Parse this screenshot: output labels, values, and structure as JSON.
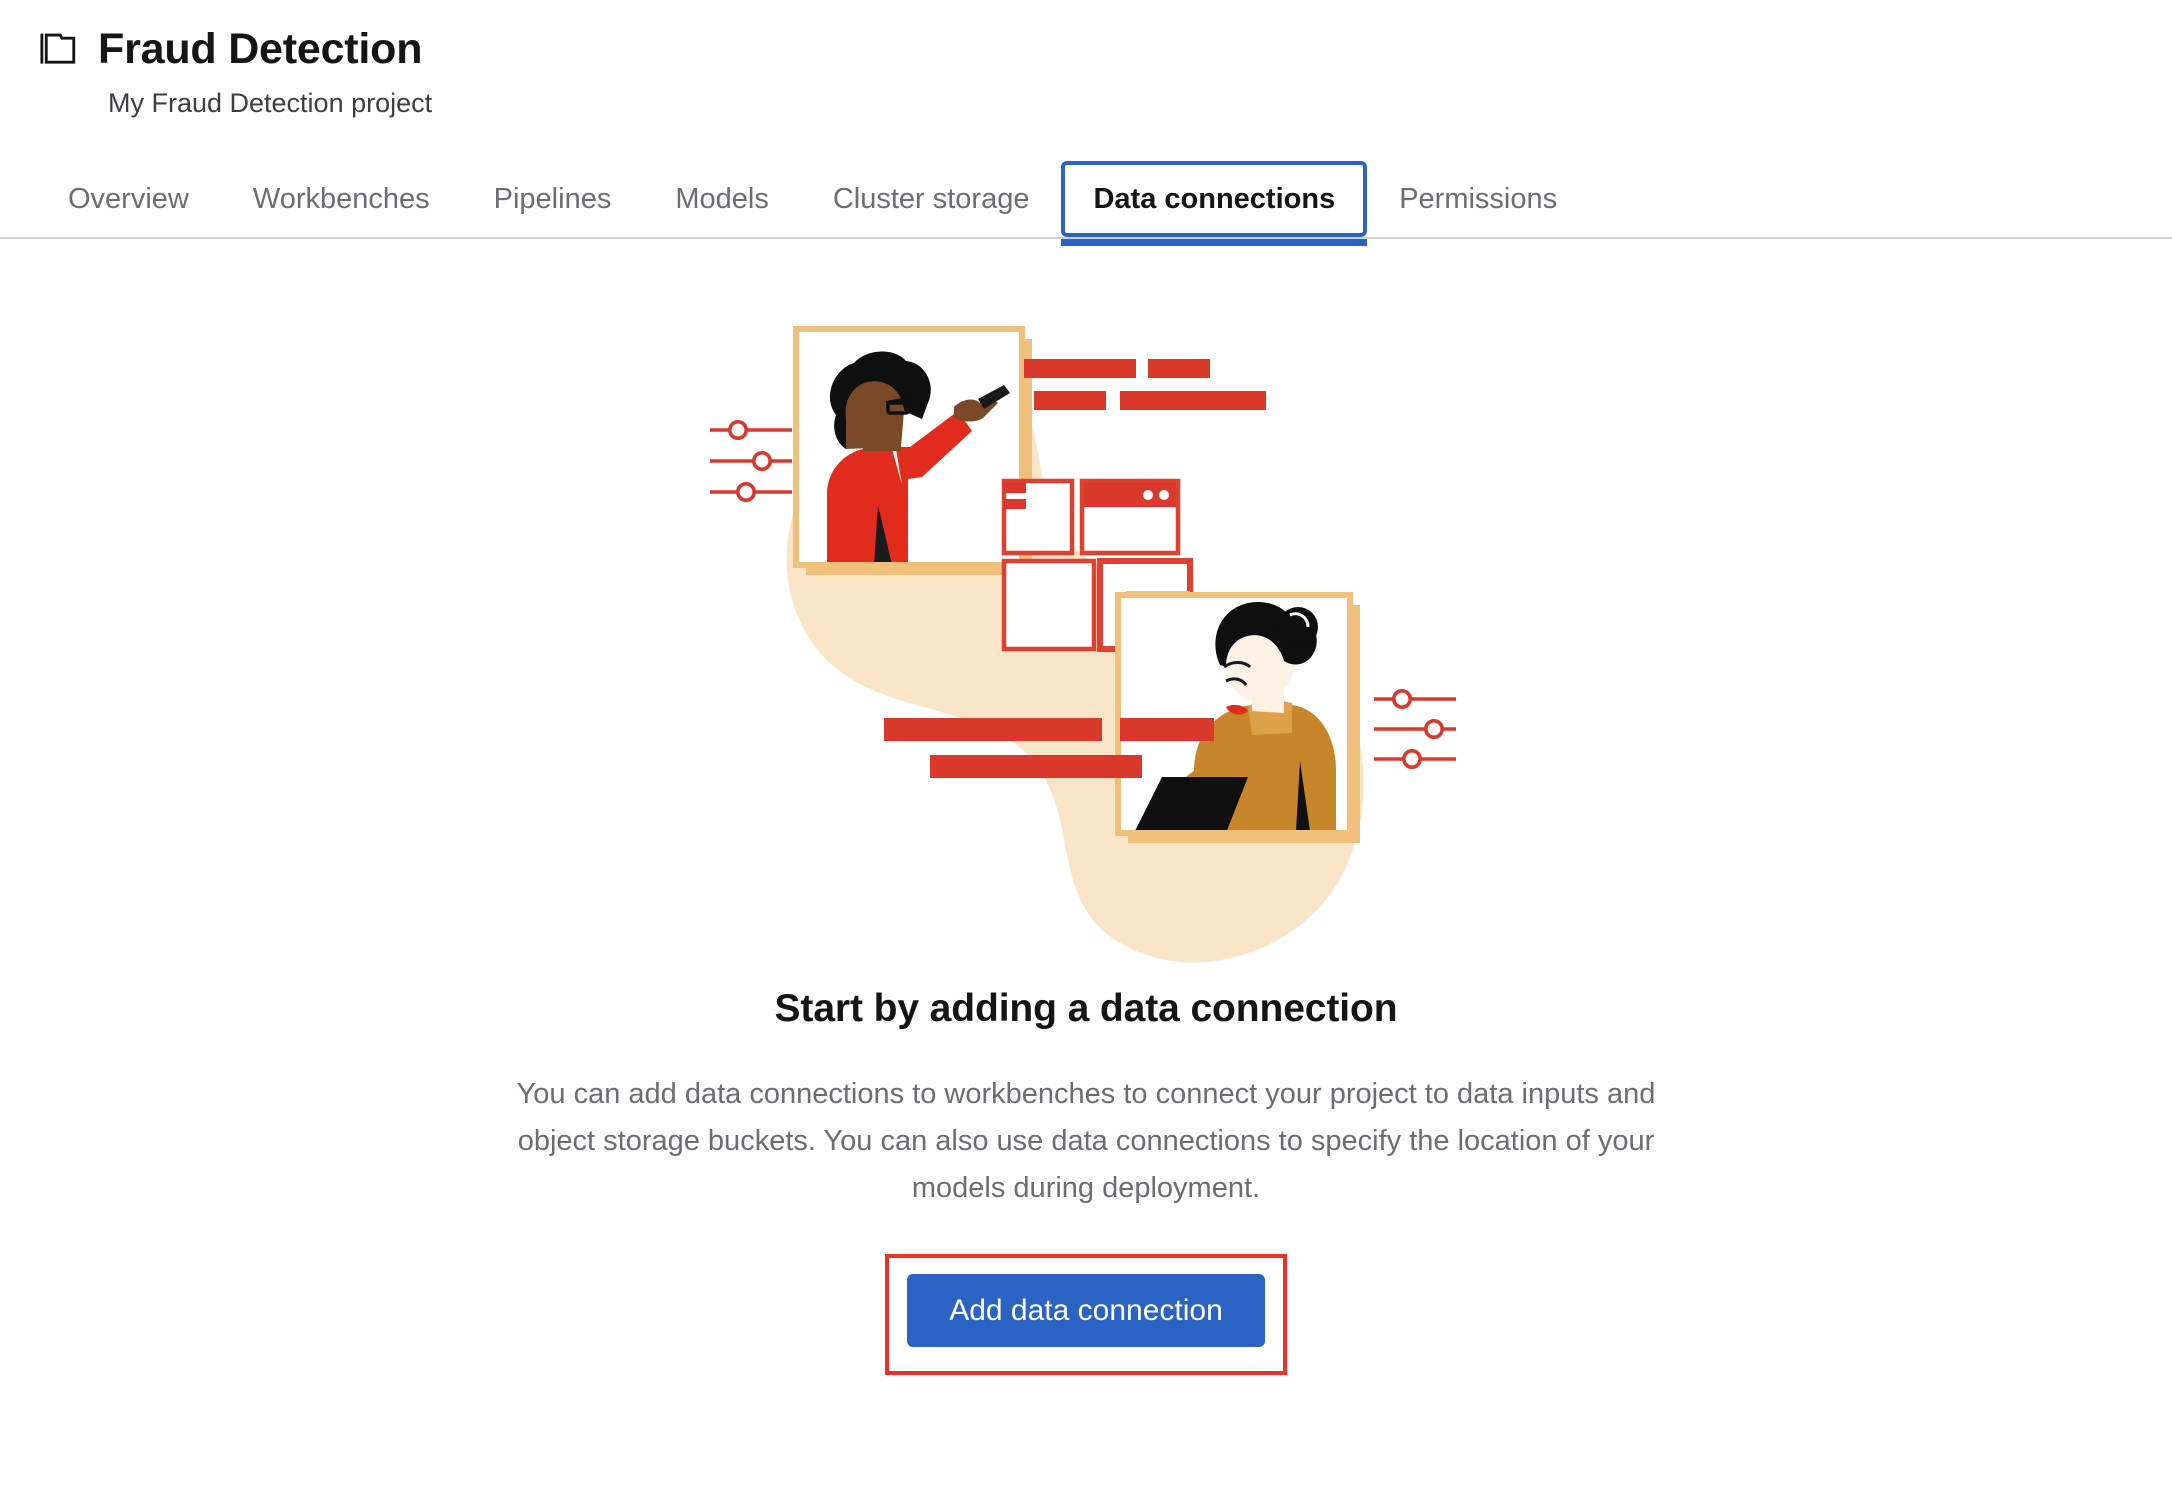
{
  "header": {
    "icon": "folder-icon",
    "title": "Fraud Detection",
    "subtitle": "My Fraud Detection project"
  },
  "tabs": [
    {
      "label": "Overview",
      "active": false
    },
    {
      "label": "Workbenches",
      "active": false
    },
    {
      "label": "Pipelines",
      "active": false
    },
    {
      "label": "Models",
      "active": false
    },
    {
      "label": "Cluster storage",
      "active": false
    },
    {
      "label": "Data connections",
      "active": true
    },
    {
      "label": "Permissions",
      "active": false
    }
  ],
  "empty_state": {
    "illustration_name": "data-connections-empty-illustration",
    "title": "Start by adding a data connection",
    "body": "You can add data connections to workbenches to connect your project to data inputs and object storage buckets. You can also use data connections to specify the location of your models during deployment.",
    "cta_label": "Add data connection"
  },
  "colors": {
    "accent_blue": "#2b63c4",
    "highlight_red": "#ee3124",
    "illustration_red": "#d8392b",
    "illustration_beige": "#f9e4c8",
    "illustration_tan": "#f0c07a",
    "illustration_gold": "#c8862a",
    "text_primary": "#151515",
    "text_muted": "#6a6e73",
    "border": "#d2d2d2"
  }
}
